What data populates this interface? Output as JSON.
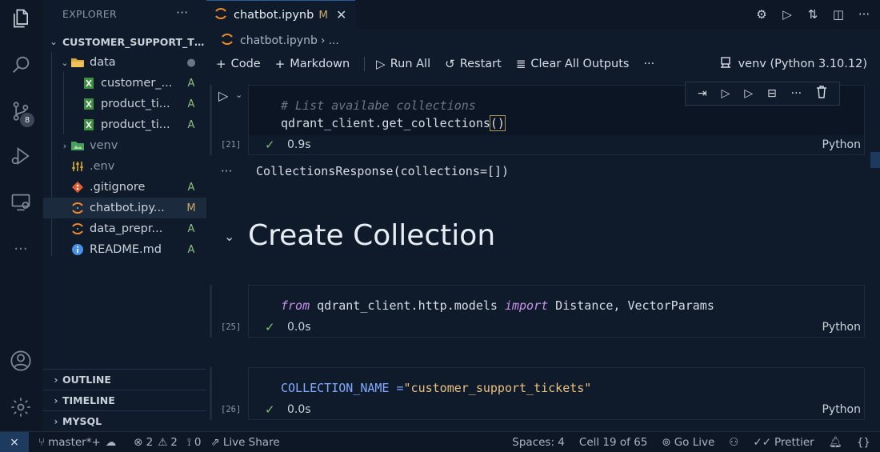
{
  "sidebar": {
    "title": "EXPLORER",
    "more": "···",
    "root": "CUSTOMER_SUPPORT_TI...",
    "items": [
      {
        "name": "data",
        "status": "",
        "dot": true
      },
      {
        "name": "customer_...",
        "status": "A"
      },
      {
        "name": "product_ti...",
        "status": "A"
      },
      {
        "name": "product_ti...",
        "status": "A"
      },
      {
        "name": "venv",
        "status": ""
      },
      {
        "name": ".env",
        "status": ""
      },
      {
        "name": ".gitignore",
        "status": "A"
      },
      {
        "name": "chatbot.ipy...",
        "status": "M"
      },
      {
        "name": "data_prepr...",
        "status": "A"
      },
      {
        "name": "README.md",
        "status": "A"
      }
    ],
    "sections": [
      "OUTLINE",
      "TIMELINE",
      "MYSQL"
    ],
    "scm_badge": "8"
  },
  "tab": {
    "name": "chatbot.ipynb",
    "modified": "M",
    "close": "✕"
  },
  "breadcrumb": {
    "file": "chatbot.ipynb",
    "sep": "›",
    "rest": "..."
  },
  "toolbar": {
    "code": "Code",
    "markdown": "Markdown",
    "run_all": "Run All",
    "restart": "Restart",
    "clear": "Clear All Outputs",
    "more": "···",
    "kernel": "venv (Python 3.10.12)"
  },
  "cells": [
    {
      "comment": "# List availabe collections",
      "code": "qdrant_client.get_collections",
      "bracket": "()",
      "count": "[21]",
      "time": "0.9s",
      "lang": "Python",
      "output": "CollectionsResponse(collections=[])"
    },
    {
      "kw1": "from",
      "mod": " qdrant_client.http.models ",
      "kw2": "import",
      "rest": " Distance, VectorParams",
      "count": "[25]",
      "time": "0.0s",
      "lang": "Python"
    },
    {
      "var": "COLLECTION_NAME",
      "op": " =",
      "str": "\"customer_support_tickets\"",
      "count": "[26]",
      "time": "0.0s",
      "lang": "Python"
    }
  ],
  "heading": "Create Collection",
  "output_dots": "···",
  "status": {
    "branch": "master*+",
    "errors": "2",
    "warnings": "2",
    "ports": "0",
    "live_share": "Live Share",
    "spaces": "Spaces: 4",
    "cell": "Cell 19 of 65",
    "go_live": "Go Live",
    "prettier": "Prettier"
  }
}
